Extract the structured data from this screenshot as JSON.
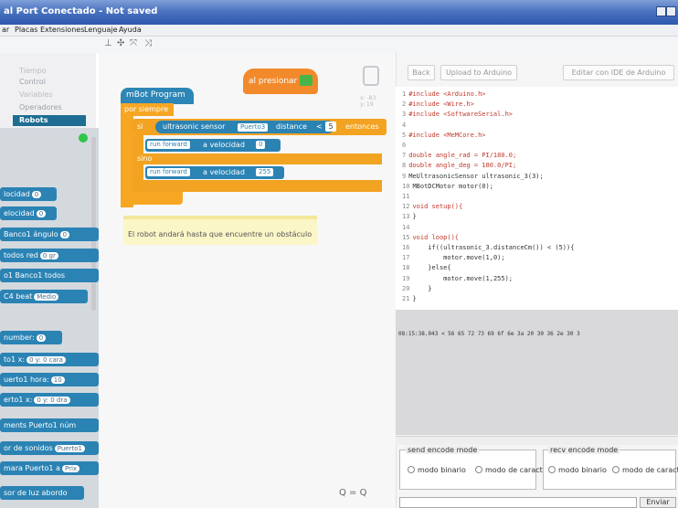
{
  "window": {
    "title": "al Port Conectado - Not saved"
  },
  "menu": [
    "ar",
    "Placas",
    "Extensiones",
    "Lenguaje",
    "Ayuda"
  ],
  "categories": [
    {
      "label": "Tiempo",
      "selected": false
    },
    {
      "label": "Control",
      "selected": false
    },
    {
      "label": "Variables",
      "selected": false
    },
    {
      "label": "Operadores",
      "selected": false
    },
    {
      "label": "Robots",
      "selected": true
    }
  ],
  "palette": [
    {
      "label": "locidad",
      "slot": "0"
    },
    {
      "label": "elocidad",
      "slot": "0"
    },
    {
      "label": "Banco1  ángulo",
      "slot": "0"
    },
    {
      "label": "todos  red",
      "slot": "0 gr"
    },
    {
      "label": "o1  Banco1  todos",
      "slot": ""
    },
    {
      "label": "C4  beat",
      "slot": "Medio"
    },
    {
      "label": "number:",
      "slot": "0"
    },
    {
      "label": "to1  x:",
      "slot": "0 y: 0 cara"
    },
    {
      "label": "uerto1  hora:",
      "slot": "10"
    },
    {
      "label": "erto1  x:",
      "slot": "0 y: 0 dra"
    },
    {
      "label": "ments  Puerto1  núm",
      "slot": ""
    },
    {
      "label": "or de sonidos",
      "slot": "Puerto1"
    },
    {
      "label": "mara  Puerto1  a",
      "slot": "Prix"
    },
    {
      "label": "sor de luz abordo",
      "slot": ""
    }
  ],
  "workspace": {
    "hat_label": "al presionar",
    "program_label": "mBot Program",
    "forever_label": "por siempre",
    "if_label": "si",
    "sensor_label": "ultrasonic sensor",
    "sensor_port": "Puerto3",
    "distance_label": "distance",
    "compare_op": "<",
    "compare_value": "5",
    "then_label": "entonces",
    "else_label": "sino",
    "motor1_dir": "run forward",
    "motor1_speed_label": "a velocidad",
    "motor1_speed": "0",
    "motor2_dir": "run forward",
    "motor2_speed_label": "a velocidad",
    "motor2_speed": "255",
    "coords_x": "x: -83",
    "coords_y": "y: 19",
    "note": "El robot andará hasta que encuentre un obstáculo",
    "zoom": "Q = Q"
  },
  "code_panel": {
    "back_label": "Back",
    "upload_label": "Upload to Arduino",
    "edit_label": "Editar con IDE de Arduino",
    "lines": [
      "#include <Arduino.h>",
      "#include <Wire.h>",
      "#include <SoftwareSerial.h>",
      "",
      "#include <MeMCore.h>",
      "",
      "double angle_rad = PI/180.0;",
      "double angle_deg = 180.0/PI;",
      "MeUltrasonicSensor ultrasonic_3(3);",
      "MBotDCMotor motor(0);",
      "",
      "void setup(){",
      "}",
      "",
      "void loop(){",
      "    if((ultrasonic_3.distanceCm()) < (5)){",
      "        motor.move(1,0);",
      "    }else{",
      "        motor.move(1,255);",
      "    }",
      "}"
    ],
    "serial_output": "08:15:38.043 < 56 65 72 73 69 6f 6e 3a 20 30 36 2e 30 3",
    "send_mode_title": "send encode mode",
    "recv_mode_title": "recv encode mode",
    "binary_label": "modo binario",
    "char_label": "modo de caracteres",
    "send_button": "Enviar"
  }
}
